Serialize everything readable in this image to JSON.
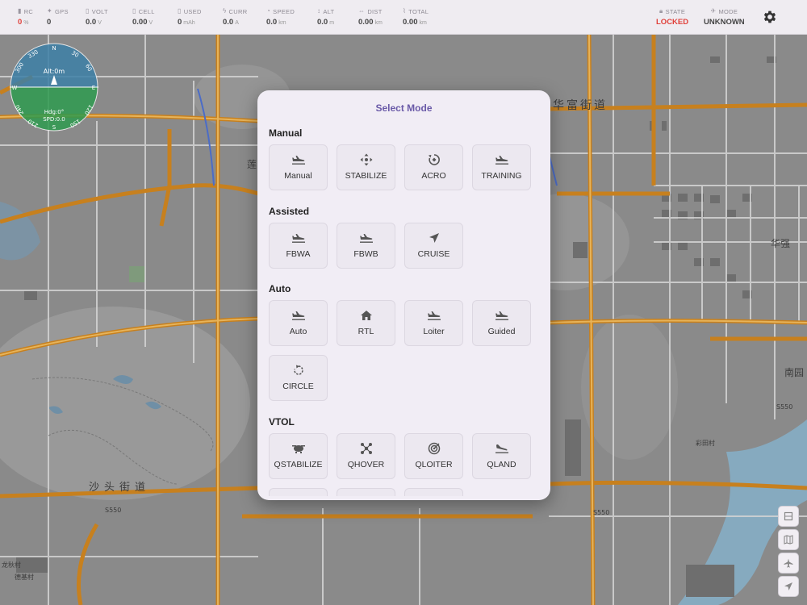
{
  "status_bar": {
    "items": [
      {
        "label": "RC",
        "icon": "signal-icon",
        "value": "0",
        "unit": "%",
        "alert": true
      },
      {
        "label": "GPS",
        "icon": "satellite-icon",
        "value": "0",
        "unit": ""
      },
      {
        "label": "VOLT",
        "icon": "battery-icon",
        "value": "0.0",
        "unit": "V"
      },
      {
        "label": "CELL",
        "icon": "battery-cell-icon",
        "value": "0.00",
        "unit": "V"
      },
      {
        "label": "USED",
        "icon": "battery-used-icon",
        "value": "0",
        "unit": "mAh"
      },
      {
        "label": "CURR",
        "icon": "bolt-icon",
        "value": "0.0",
        "unit": "A"
      },
      {
        "label": "SPEED",
        "icon": "speedometer-icon",
        "value": "0.0",
        "unit": "km"
      },
      {
        "label": "ALT",
        "icon": "altitude-icon",
        "value": "0.0",
        "unit": "m"
      },
      {
        "label": "DIST",
        "icon": "distance-icon",
        "value": "0.00",
        "unit": "km"
      },
      {
        "label": "TOTAL",
        "icon": "route-icon",
        "value": "0.00",
        "unit": "km"
      }
    ],
    "state": {
      "label": "STATE",
      "value": "LOCKED",
      "icon": "lock-icon"
    },
    "mode": {
      "label": "MODE",
      "value": "UNKNOWN",
      "icon": "plane-icon"
    },
    "settings_icon": "gear-icon"
  },
  "compass": {
    "alt_text": "Alt:0m",
    "hdg_text": "Hdg:0°",
    "spd_text": "SPD:0.0",
    "cardinals": [
      "N",
      "E",
      "S",
      "W"
    ],
    "degree_labels": [
      "30",
      "60",
      "120",
      "150",
      "210",
      "240",
      "300",
      "330"
    ]
  },
  "map_labels": {
    "road_1": "华富街道",
    "road_2": "沙头街道",
    "road_3": "S550",
    "road_4": "S550",
    "road_5": "S550",
    "area_1": "南园",
    "area_2": "华强",
    "area_3": "莲",
    "area_4": "龙秋村",
    "area_5": "德基村",
    "area_6": "彩田村"
  },
  "modal": {
    "title": "Select Mode",
    "sections": [
      {
        "name": "Manual",
        "modes": [
          {
            "label": "Manual",
            "icon": "plane-icon"
          },
          {
            "label": "STABILIZE",
            "icon": "move-arrows-icon"
          },
          {
            "label": "ACRO",
            "icon": "rotate-icon"
          },
          {
            "label": "TRAINING",
            "icon": "plane-icon"
          }
        ]
      },
      {
        "name": "Assisted",
        "modes": [
          {
            "label": "FBWA",
            "icon": "plane-icon"
          },
          {
            "label": "FBWB",
            "icon": "plane-icon"
          },
          {
            "label": "CRUISE",
            "icon": "navigation-icon"
          }
        ]
      },
      {
        "name": "Auto",
        "modes": [
          {
            "label": "Auto",
            "icon": "plane-icon"
          },
          {
            "label": "RTL",
            "icon": "home-icon"
          },
          {
            "label": "Loiter",
            "icon": "plane-icon"
          },
          {
            "label": "Guided",
            "icon": "plane-icon"
          },
          {
            "label": "CIRCLE",
            "icon": "circle-arrow-icon"
          }
        ]
      },
      {
        "name": "VTOL",
        "modes": [
          {
            "label": "QSTABILIZE",
            "icon": "drone-icon"
          },
          {
            "label": "QHOVER",
            "icon": "quadcopter-icon"
          },
          {
            "label": "QLOITER",
            "icon": "target-icon"
          },
          {
            "label": "QLAND",
            "icon": "landing-icon"
          }
        ]
      }
    ]
  },
  "side_buttons": [
    "layers-icon",
    "map-icon",
    "airplane-icon",
    "navigation-icon"
  ]
}
